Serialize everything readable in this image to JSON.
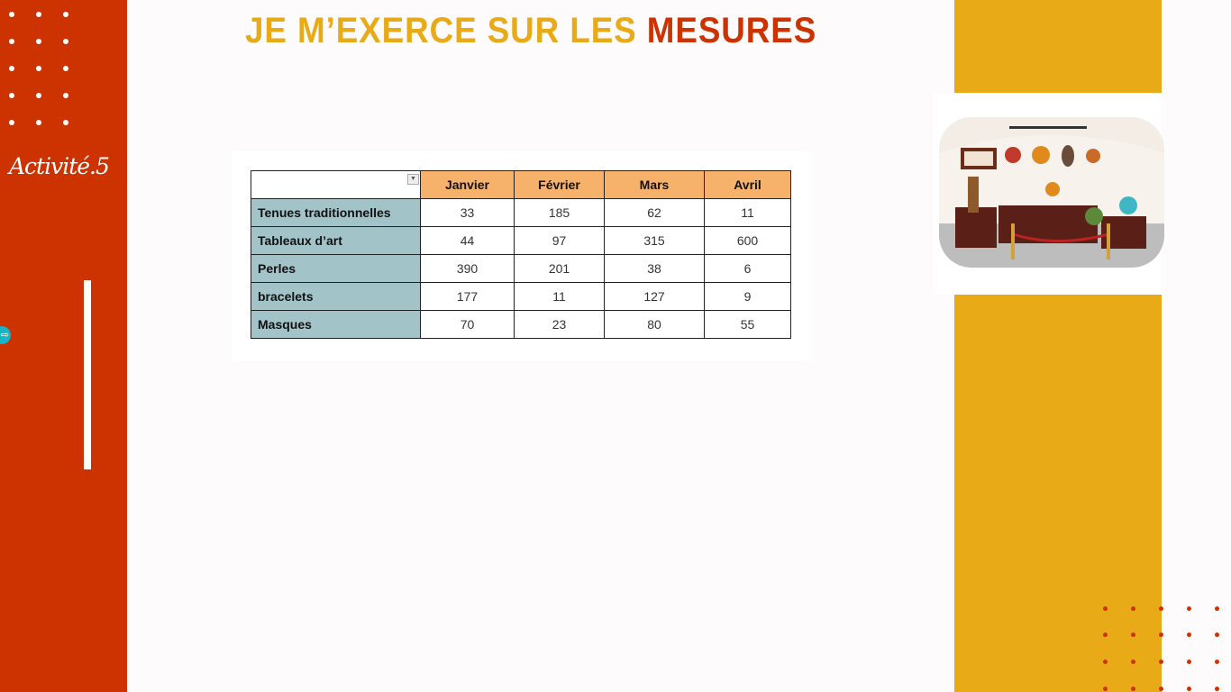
{
  "header": {
    "title_main": "JE M’EXERCE SUR LES ",
    "title_accent": "MESURES"
  },
  "sidebar": {
    "activity_label": "Activité.5"
  },
  "table": {
    "columns": [
      "Janvier",
      "Février",
      "Mars",
      "Avril"
    ],
    "rows": [
      {
        "label": "Tenues traditionnelles",
        "values": [
          "33",
          "185",
          "62",
          "11"
        ]
      },
      {
        "label": "Tableaux d’art",
        "values": [
          "44",
          "97",
          "315",
          "600"
        ]
      },
      {
        "label": "Perles",
        "values": [
          "390",
          "201",
          "38",
          "6"
        ]
      },
      {
        "label": "bracelets",
        "values": [
          "177",
          "11",
          "127",
          "9"
        ]
      },
      {
        "label": "Masques",
        "values": [
          "70",
          "23",
          "80",
          "55"
        ]
      }
    ]
  },
  "colors": {
    "red": "#cc3300",
    "yellow": "#e8aa17",
    "header_bg": "#f6b26b",
    "label_bg": "#a2c4c9"
  }
}
